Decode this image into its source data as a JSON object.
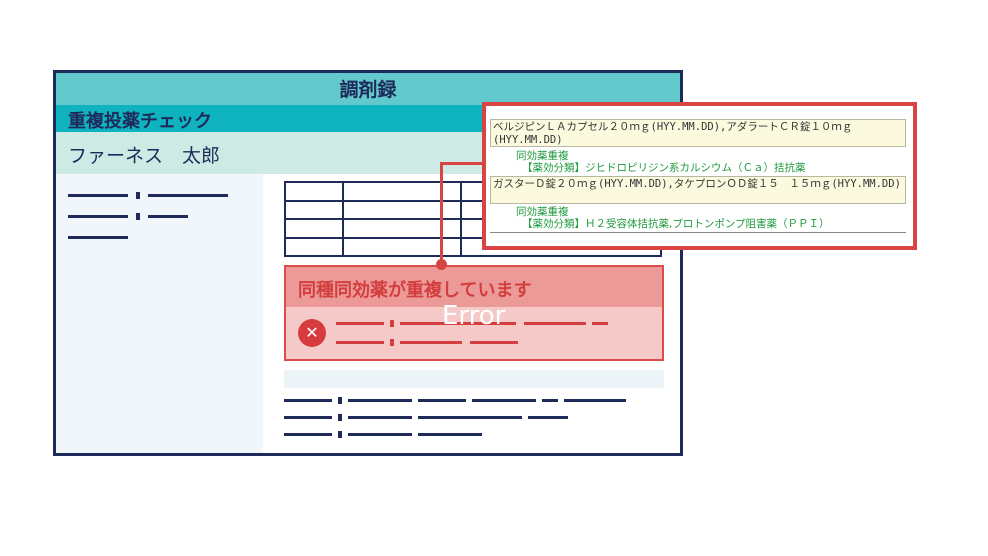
{
  "window": {
    "title": "調剤録",
    "section_title": "重複投薬チェック",
    "patient_name": "ファーネス　太郎"
  },
  "error": {
    "heading": "同種同効薬が重複しています",
    "overlay_label": "Error",
    "icon": "close-circle-icon"
  },
  "panel": {
    "entries": [
      {
        "drug": "ベルジピンＬＡカプセル２０ｍｇ(HYY.MM.DD),アダラートＣＲ錠１０ｍｇ(HYY.MM.DD)",
        "dup_label": "同効薬重複",
        "dup_class": "【薬効分類】ジヒドロピリジン系カルシウム（Ｃａ）拮抗薬"
      },
      {
        "drug": "ガスターＤ錠２０ｍｇ(HYY.MM.DD),タケプロンＯＤ錠１５　１５ｍｇ(HYY.MM.DD)",
        "dup_label": "同効薬重複",
        "dup_class": "【薬効分類】Ｈ２受容体拮抗薬,プロトンポンプ阻害薬（ＰＰＩ）"
      }
    ]
  },
  "colors": {
    "navy": "#1e2a5a",
    "teal": "#62c9cc",
    "error_red": "#d84343",
    "dup_green": "#1f9a3e"
  }
}
